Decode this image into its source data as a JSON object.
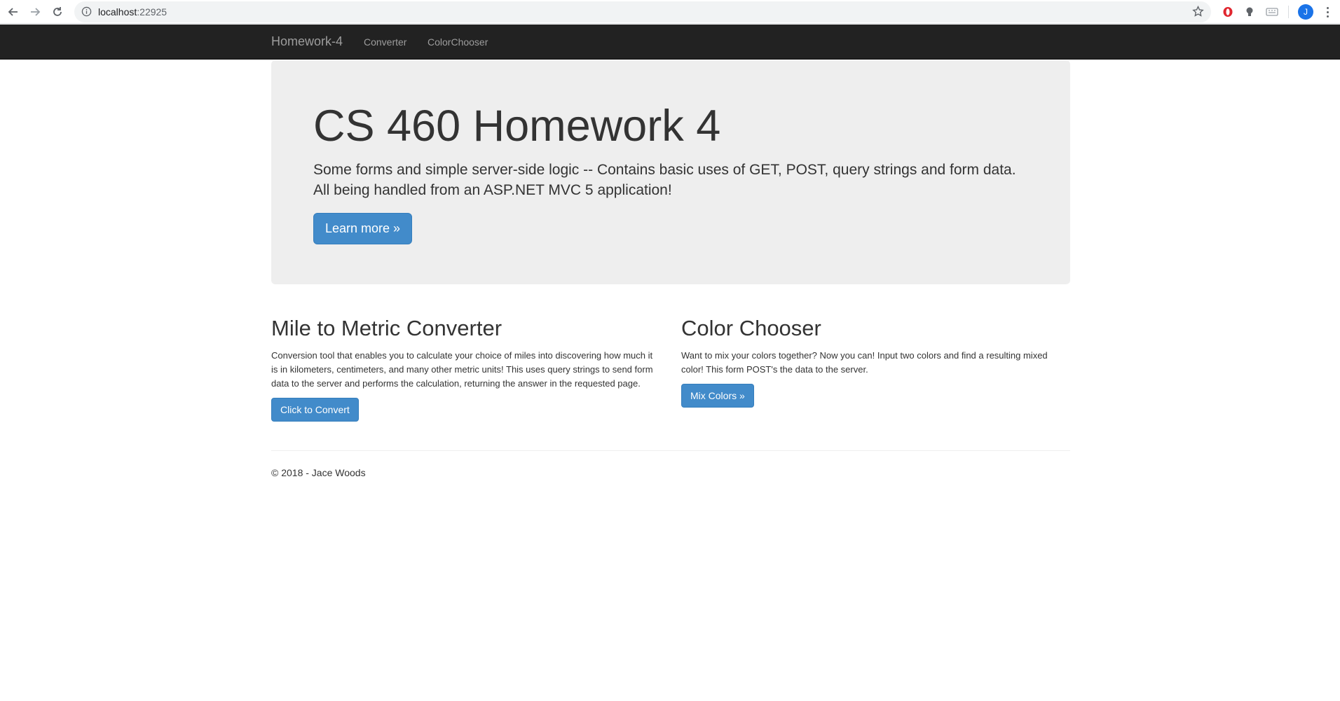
{
  "browser": {
    "url_host": "localhost",
    "url_port": ":22925",
    "avatar_letter": "J"
  },
  "navbar": {
    "brand": "Homework-4",
    "links": [
      "Converter",
      "ColorChooser"
    ]
  },
  "jumbotron": {
    "title": "CS 460 Homework 4",
    "lead": "Some forms and simple server-side logic -- Contains basic uses of GET, POST, query strings and form data. All being handled from an ASP.NET MVC 5 application!",
    "button": "Learn more »"
  },
  "sections": [
    {
      "title": "Mile to Metric Converter",
      "text": "Conversion tool that enables you to calculate your choice of miles into discovering how much it is in kilometers, centimeters, and many other metric units! This uses query strings to send form data to the server and performs the calculation, returning the answer in the requested page.",
      "button": "Click to Convert"
    },
    {
      "title": "Color Chooser",
      "text": "Want to mix your colors together? Now you can! Input two colors and find a resulting mixed color! This form POST's the data to the server.",
      "button": "Mix Colors »"
    }
  ],
  "footer": {
    "text": "© 2018 - Jace Woods"
  },
  "colors": {
    "navbar_bg": "#222222",
    "jumbotron_bg": "#eeeeee",
    "primary": "#428bca"
  }
}
